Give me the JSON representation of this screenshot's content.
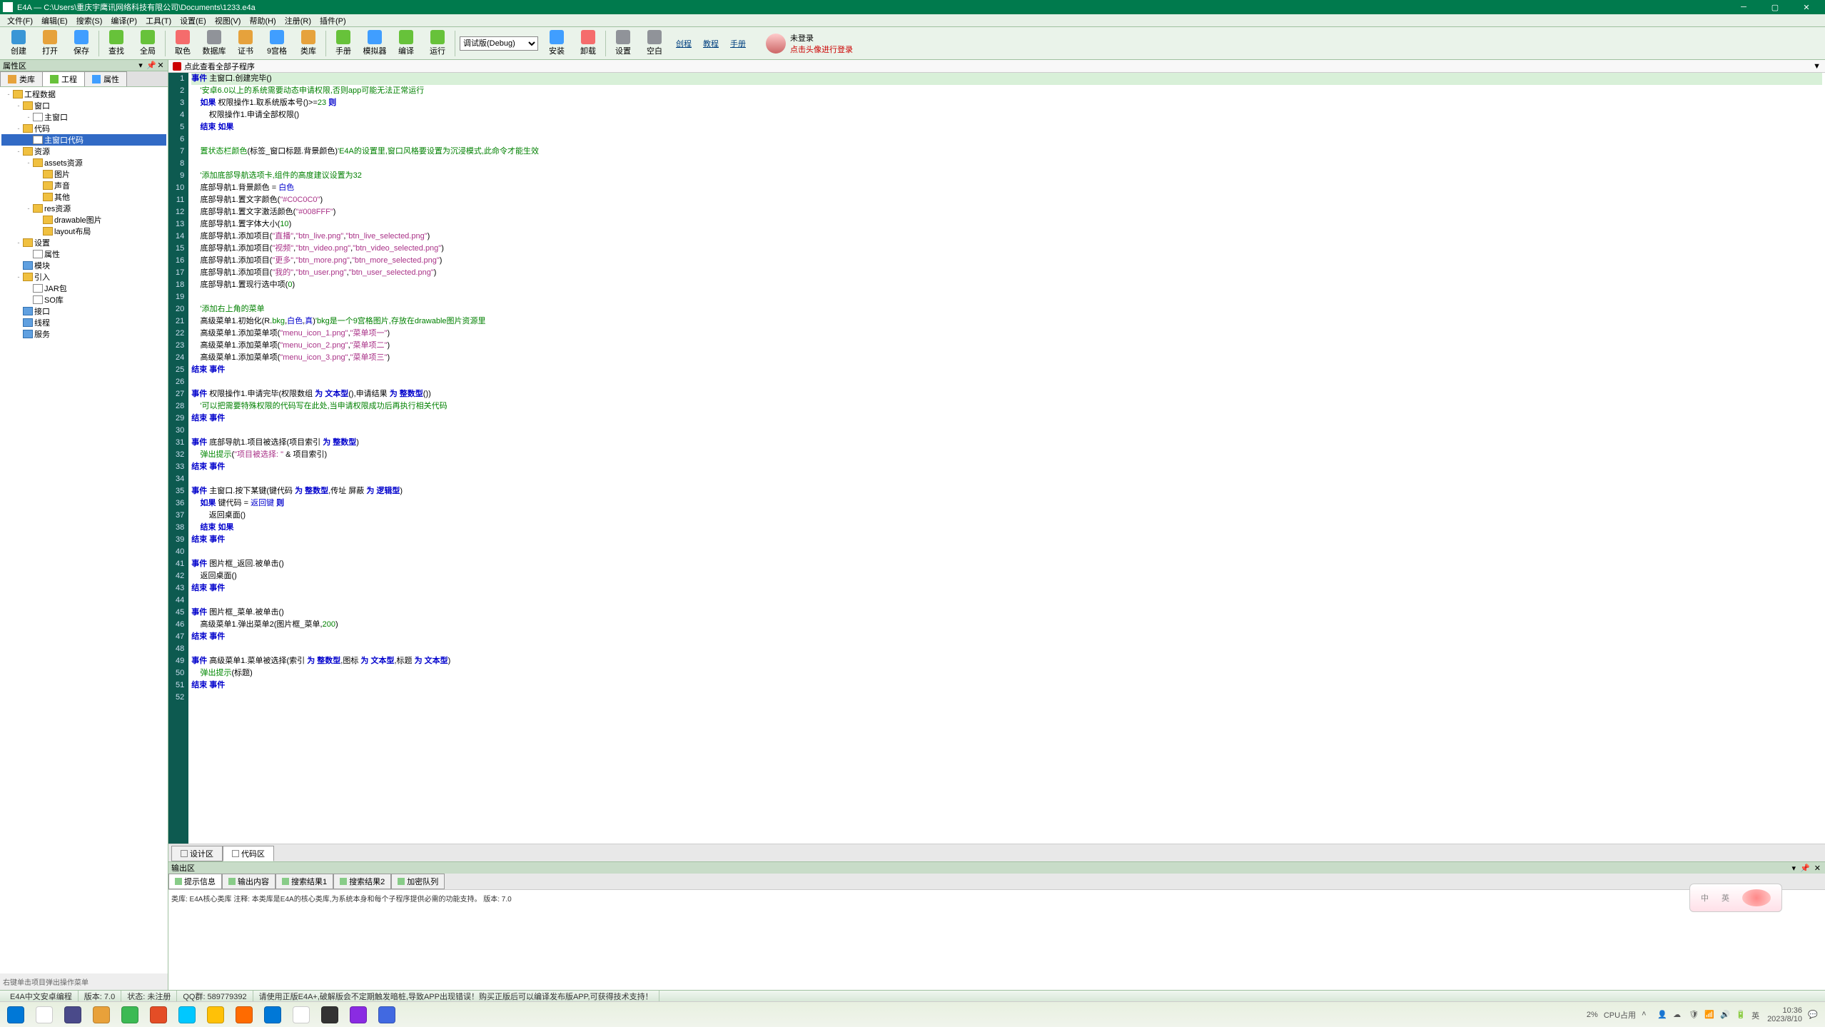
{
  "title": "E4A — C:\\Users\\重庆宇鹰讯网络科技有限公司\\Documents\\1233.e4a",
  "menus": [
    "文件(F)",
    "编辑(E)",
    "搜索(S)",
    "编译(P)",
    "工具(T)",
    "设置(E)",
    "视图(V)",
    "帮助(H)",
    "注册(R)",
    "插件(P)"
  ],
  "toolbar": [
    {
      "label": "创建",
      "color": "#3a96d6"
    },
    {
      "label": "打开",
      "color": "#e6a23c"
    },
    {
      "label": "保存",
      "color": "#409eff"
    },
    {
      "sep": true
    },
    {
      "label": "查找",
      "color": "#67c23a"
    },
    {
      "label": "全局",
      "color": "#67c23a"
    },
    {
      "sep": true
    },
    {
      "label": "取色",
      "color": "#f56c6c"
    },
    {
      "label": "数据库",
      "color": "#909399"
    },
    {
      "label": "证书",
      "color": "#e6a23c"
    },
    {
      "label": "9宫格",
      "color": "#409eff"
    },
    {
      "label": "类库",
      "color": "#e6a23c"
    },
    {
      "sep": true
    },
    {
      "label": "手册",
      "color": "#67c23a"
    },
    {
      "label": "模拟器",
      "color": "#409eff"
    },
    {
      "label": "编译",
      "color": "#67c23a"
    },
    {
      "label": "运行",
      "color": "#67c23a"
    },
    {
      "sep": true
    },
    {
      "combo": "调试版(Debug)"
    },
    {
      "label": "安装",
      "color": "#409eff"
    },
    {
      "label": "卸载",
      "color": "#f56c6c"
    },
    {
      "sep": true
    },
    {
      "label": "设置",
      "color": "#909399"
    },
    {
      "label": "空白",
      "color": "#909399"
    }
  ],
  "toolbar_links": [
    "创程",
    "教程",
    "手册"
  ],
  "login": {
    "a": "未登录",
    "b": "点击头像进行登录"
  },
  "left": {
    "hdr": "属性区",
    "tabs": [
      {
        "l": "类库"
      },
      {
        "l": "工程",
        "active": true
      },
      {
        "l": "属性"
      }
    ],
    "tree": [
      {
        "d": 0,
        "t": "工程数据",
        "i": "folder",
        "e": "-"
      },
      {
        "d": 1,
        "t": "窗口",
        "i": "folder",
        "e": "-"
      },
      {
        "d": 2,
        "t": "主窗口",
        "i": "file",
        "e": "-"
      },
      {
        "d": 1,
        "t": "代码",
        "i": "folder",
        "e": "-"
      },
      {
        "d": 2,
        "t": "主窗口代码",
        "i": "file",
        "sel": true
      },
      {
        "d": 1,
        "t": "资源",
        "i": "folder",
        "e": "-"
      },
      {
        "d": 2,
        "t": "assets资源",
        "i": "folder",
        "e": "-"
      },
      {
        "d": 3,
        "t": "图片",
        "i": "folder"
      },
      {
        "d": 3,
        "t": "声音",
        "i": "folder"
      },
      {
        "d": 3,
        "t": "其他",
        "i": "folder"
      },
      {
        "d": 2,
        "t": "res资源",
        "i": "folder",
        "e": "-"
      },
      {
        "d": 3,
        "t": "drawable图片",
        "i": "folder"
      },
      {
        "d": 3,
        "t": "layout布局",
        "i": "folder"
      },
      {
        "d": 1,
        "t": "设置",
        "i": "folder",
        "e": "-"
      },
      {
        "d": 2,
        "t": "属性",
        "i": "file"
      },
      {
        "d": 1,
        "t": "模块",
        "i": "module"
      },
      {
        "d": 1,
        "t": "引入",
        "i": "folder",
        "e": "-"
      },
      {
        "d": 2,
        "t": "JAR包",
        "i": "file"
      },
      {
        "d": 2,
        "t": "SO库",
        "i": "file"
      },
      {
        "d": 1,
        "t": "接口",
        "i": "module"
      },
      {
        "d": 1,
        "t": "线程",
        "i": "module"
      },
      {
        "d": 1,
        "t": "服务",
        "i": "module"
      }
    ],
    "footer": "右键单击项目弹出操作菜单"
  },
  "crumb": {
    "text": "点此查看全部子程序"
  },
  "code": [
    {
      "n": 1,
      "hl": true,
      "h": "<span class='kw'>事件</span> 主窗口.创建完毕()"
    },
    {
      "n": 2,
      "h": "    <span class='cmt'>'安卓6.0以上的系统需要动态申请权限,否则app可能无法正常运行</span>"
    },
    {
      "n": 3,
      "h": "    <span class='kw'>如果</span> 权限操作1.取系统版本号()&gt;=<span class='num'>23</span> <span class='kw'>则</span>"
    },
    {
      "n": 4,
      "h": "        权限操作1.申请全部权限()"
    },
    {
      "n": 5,
      "h": "    <span class='kw'>结束 如果</span>"
    },
    {
      "n": 6,
      "h": ""
    },
    {
      "n": 7,
      "h": "    <span class='op'>置状态栏颜色</span>(标签_窗口标题.背景颜色)<span class='cmt'>'E4A的设置里,窗口风格要设置为沉浸模式,此命令才能生效</span>"
    },
    {
      "n": 8,
      "h": ""
    },
    {
      "n": 9,
      "h": "    <span class='cmt'>'添加底部导航选项卡,组件的高度建议设置为32</span>"
    },
    {
      "n": 10,
      "h": "    底部导航1.背景颜色 = <span class='tk'>白色</span>"
    },
    {
      "n": 11,
      "h": "    底部导航1.置文字颜色(<span class='str'>\"#C0C0C0\"</span>)"
    },
    {
      "n": 12,
      "h": "    底部导航1.置文字激活颜色(<span class='str'>\"#008FFF\"</span>)"
    },
    {
      "n": 13,
      "h": "    底部导航1.置字体大小(<span class='num'>10</span>)"
    },
    {
      "n": 14,
      "h": "    底部导航1.添加项目(<span class='str'>\"直播\"</span>,<span class='str'>\"btn_live.png\"</span>,<span class='str'>\"btn_live_selected.png\"</span>)"
    },
    {
      "n": 15,
      "h": "    底部导航1.添加项目(<span class='str'>\"视频\"</span>,<span class='str'>\"btn_video.png\"</span>,<span class='str'>\"btn_video_selected.png\"</span>)"
    },
    {
      "n": 16,
      "h": "    底部导航1.添加项目(<span class='str'>\"更多\"</span>,<span class='str'>\"btn_more.png\"</span>,<span class='str'>\"btn_more_selected.png\"</span>)"
    },
    {
      "n": 17,
      "h": "    底部导航1.添加项目(<span class='str'>\"我的\"</span>,<span class='str'>\"btn_user.png\"</span>,<span class='str'>\"btn_user_selected.png\"</span>)"
    },
    {
      "n": 18,
      "h": "    底部导航1.置现行选中项(<span class='num'>0</span>)"
    },
    {
      "n": 19,
      "h": ""
    },
    {
      "n": 20,
      "h": "    <span class='cmt'>'添加右上角的菜单</span>"
    },
    {
      "n": 21,
      "h": "    高级菜单1.初始化(R.<span class='op'>bkg</span>,<span class='tk'>白色</span>,<span class='tk'>真</span>)<span class='cmt'>'bkg是一个9宫格图片,存放在drawable图片资源里</span>"
    },
    {
      "n": 22,
      "h": "    高级菜单1.添加菜单项(<span class='str'>\"menu_icon_1.png\"</span>,<span class='str'>\"菜单项一\"</span>)"
    },
    {
      "n": 23,
      "h": "    高级菜单1.添加菜单项(<span class='str'>\"menu_icon_2.png\"</span>,<span class='str'>\"菜单项二\"</span>)"
    },
    {
      "n": 24,
      "h": "    高级菜单1.添加菜单项(<span class='str'>\"menu_icon_3.png\"</span>,<span class='str'>\"菜单项三\"</span>)"
    },
    {
      "n": 25,
      "h": "<span class='kw'>结束 事件</span>"
    },
    {
      "n": 26,
      "h": ""
    },
    {
      "n": 27,
      "h": "<span class='kw'>事件</span> 权限操作1.申请完毕(权限数组 <span class='kw'>为 文本型</span>(),申请结果 <span class='kw'>为 整数型</span>())"
    },
    {
      "n": 28,
      "h": "    <span class='cmt'>'可以把需要特殊权限的代码写在此处,当申请权限成功后再执行相关代码</span>"
    },
    {
      "n": 29,
      "h": "<span class='kw'>结束 事件</span>"
    },
    {
      "n": 30,
      "h": ""
    },
    {
      "n": 31,
      "h": "<span class='kw'>事件</span> 底部导航1.项目被选择(项目索引 <span class='kw'>为 整数型</span>)"
    },
    {
      "n": 32,
      "h": "    <span class='op'>弹出提示</span>(<span class='str'>\"项目被选择: \"</span> &amp; 项目索引)"
    },
    {
      "n": 33,
      "h": "<span class='kw'>结束 事件</span>"
    },
    {
      "n": 34,
      "h": ""
    },
    {
      "n": 35,
      "h": "<span class='kw'>事件</span> 主窗口.按下某键(键代码 <span class='kw'>为 整数型</span>,传址 屏蔽 <span class='kw'>为 逻辑型</span>)"
    },
    {
      "n": 36,
      "h": "    <span class='kw'>如果</span> 键代码 = <span class='tk'>返回键</span> <span class='kw'>则</span>"
    },
    {
      "n": 37,
      "h": "        返回桌面()"
    },
    {
      "n": 38,
      "h": "    <span class='kw'>结束 如果</span>"
    },
    {
      "n": 39,
      "h": "<span class='kw'>结束 事件</span>"
    },
    {
      "n": 40,
      "h": ""
    },
    {
      "n": 41,
      "h": "<span class='kw'>事件</span> 图片框_返回.被单击()"
    },
    {
      "n": 42,
      "h": "    返回桌面()"
    },
    {
      "n": 43,
      "h": "<span class='kw'>结束 事件</span>"
    },
    {
      "n": 44,
      "h": ""
    },
    {
      "n": 45,
      "h": "<span class='kw'>事件</span> 图片框_菜单.被单击()"
    },
    {
      "n": 46,
      "h": "    高级菜单1.弹出菜单2(图片框_菜单,<span class='num'>200</span>)"
    },
    {
      "n": 47,
      "h": "<span class='kw'>结束 事件</span>"
    },
    {
      "n": 48,
      "h": ""
    },
    {
      "n": 49,
      "h": "<span class='kw'>事件</span> 高级菜单1.菜单被选择(索引 <span class='kw'>为 整数型</span>,图标 <span class='kw'>为 文本型</span>,标题 <span class='kw'>为 文本型</span>)"
    },
    {
      "n": 50,
      "h": "    <span class='op'>弹出提示</span>(标题)"
    },
    {
      "n": 51,
      "h": "<span class='kw'>结束 事件</span>"
    },
    {
      "n": 52,
      "h": ""
    }
  ],
  "bottabs": [
    {
      "l": "设计区"
    },
    {
      "l": "代码区",
      "active": true
    }
  ],
  "output": {
    "hdr": "输出区",
    "tabs": [
      {
        "l": "提示信息",
        "active": true
      },
      {
        "l": "输出内容"
      },
      {
        "l": "搜索结果1"
      },
      {
        "l": "搜索结果2"
      },
      {
        "l": "加密队列"
      }
    ],
    "body": "类库: E4A核心类库\n注释: 本类库是E4A的核心类库,为系统本身和每个子程序提供必需的功能支持。\n版本: 7.0"
  },
  "status": [
    "E4A中文安卓编程",
    "版本: 7.0",
    "状态: 未注册",
    "QQ群: 589779392",
    "请使用正版E4A+,破解版会不定期触发暗桩,导致APP出现错误！购买正版后可以编译发布版APP,可获得技术支持！"
  ],
  "taskbar": {
    "apps": [
      {
        "c": "#0078d7"
      },
      {
        "c": "#ffffff"
      },
      {
        "c": "#4a4a8a"
      },
      {
        "c": "#e8a13a"
      },
      {
        "c": "#3cba54"
      },
      {
        "c": "#e44d26"
      },
      {
        "c": "#00c8ff"
      },
      {
        "c": "#ffc107"
      },
      {
        "c": "#ff6b00"
      },
      {
        "c": "#0078d7"
      },
      {
        "c": "#ffffff"
      },
      {
        "c": "#333333"
      },
      {
        "c": "#8a2be2"
      },
      {
        "c": "#4169e1"
      }
    ],
    "tray": {
      "pct": "2%",
      "cpulabel": "CPU占用",
      "time": "10:36",
      "date": "2023/8/10"
    }
  }
}
